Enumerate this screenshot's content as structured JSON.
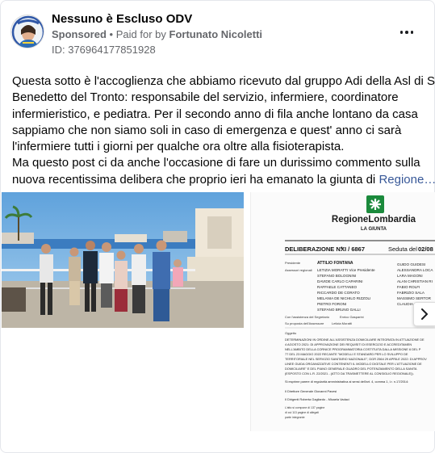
{
  "post": {
    "page_name": "Nessuno è Escluso ODV",
    "sponsored_label": "Sponsored",
    "separator": "•",
    "paid_for_by_label": "Paid for by",
    "payer": "Fortunato Nicoletti",
    "id_line": "ID: 376964177851928",
    "text_lines": [
      "Questa sotto è l'accoglienza che abbiamo ricevuto dal gruppo Adi della Asl di San",
      "Benedetto del Tronto: responsabile del servizio, infermiere, coordinatore",
      "infermieristico, e pediatra. Per il secondo anno di fila anche lontano da casa",
      "sappiamo che non siamo soli in caso di emergenza e quest' anno ci sarà",
      "l'infermiere tutti i giorni per qualche ora oltre alla fisioterapista.",
      "Ma questo post ci da anche l'occasione di fare un durissimo commento sulla",
      "nuova recentissima delibera che proprio ieri ha emanato la giunta di"
    ],
    "text_link_tail": "Regione…"
  },
  "document": {
    "region_name": "RegioneLombardia",
    "giunta": "LA GIUNTA",
    "deliberazione_label": "DELIBERAZIONE N°",
    "deliberazione_number": "XI / 6867",
    "seduta_label": "Seduta del",
    "seduta_date": "02/08",
    "presidente_label": "Presidente",
    "presidente_name": "ATTILIO FONTANA",
    "assessori_label": "Assessori regionali",
    "assessori_left": [
      "LETIZIA MORATTI  Vice Presidente",
      "STEFANO BOLOGNINI",
      "DAVIDE CARLO CAPARINI",
      "RAFFAELE CATTANEO",
      "RICCARDO DE CORATO",
      "MELANIA DE NICHILO RIZZOLI",
      "PIETRO FORONI",
      "STEFANO BRUNO GALLI"
    ],
    "assessori_right": [
      "GUIDO GUIDESI",
      "ALESSANDRA LOCA",
      "LARA MAGONI",
      "ALAN CHRISTIAN RI",
      "FABIO ROLFI",
      "FABRIZIO SALA",
      "MASSIMO SERTOR",
      "CLAUDIA"
    ],
    "assistenza_label": "Con l'assistenza del Segretario",
    "assistenza_name": "Enrico Gasparini",
    "proposta_label": "Su proposta dell'Assessore",
    "proposta_name": "Letizia Moratti",
    "oggetto_label": "Oggetto",
    "oggetto_lines": [
      "DETERMINAZIONI IN ORDINE ALL'ASSISTENZA DOMICILIARE INTEGRATA IN ATTUAZIONE DE",
      "4 AGOSTO 2021: DI APPROVAZIONE DEI REQUISITI DI ESERCIZIO E ACCREDITAMEN",
      "NELL'AMBITO DELLA CORNICE PROGRAMMATORIA COSTITUITA DALLA MISSIONE 6 DEL P",
      "77 DEL 23 MAGGIO 2022 RECANTE \"MODELLI E STANDARD PER LO SVILUPPO DE",
      "TERRITORIALE NEL SERVIZIO SANITARIO NAZIONALE\", DGR 2564 29 APRILE 2022: DI APPROV",
      "LINEE GUIDA ORGANIZZATIVE CONTENENTI IL MODELLO DIGITALE PER L'ATTUAZIONE DE",
      "DOMICILIARE\" E DEL PIANO GENERALE GUADRO DEL POTENZIAMENTO DELLA SANITA",
      "(ESPOSTO CON L.R. 22/2021 - (ATTO DA TRASMETTERE AL CONSIGLIO REGIONALE))."
    ],
    "parere_line": "Si esprime parere di regolarità amministrativa ai sensi dell'art. 4, comma 1, l.r. n.17/2014:",
    "direttore_line": "Il Direttore Generale  Giovanni Pavesi",
    "dirigenti_line": "Il Dirigenti   Roberta Gagliardo  -  Micaela Vadaci",
    "footer_lines": [
      "L'atto si compone di  137  pagine",
      "di cui 113 pagine di allegati",
      "parte integrante"
    ]
  },
  "colors": {
    "link": "#385898",
    "secondary_text": "#65676b",
    "lombardia_green": "#1b8a3c"
  },
  "icons": {
    "more": "more-horizontal-icon",
    "next": "chevron-right-icon"
  }
}
